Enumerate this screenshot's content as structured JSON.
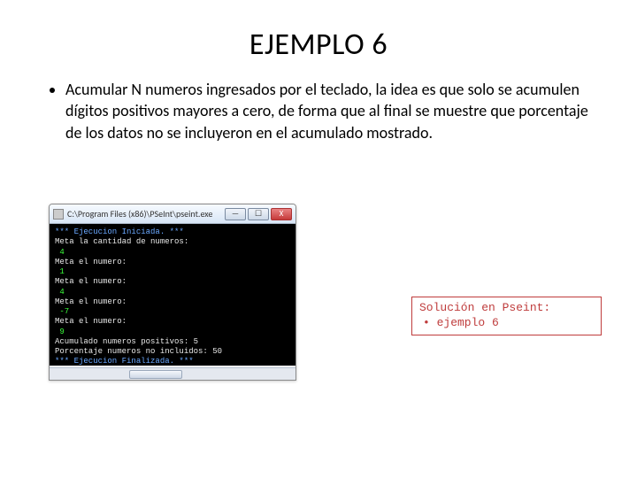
{
  "title": "EJEMPLO 6",
  "bullet": "Acumular N numeros ingresados por el teclado, la idea es que solo se acumulen dígitos positivos mayores a cero, de forma que al final se muestre que porcentaje de los datos no se incluyeron en el acumulado mostrado.",
  "console": {
    "window_title": "C:\\Program Files (x86)\\PSeInt\\pseint.exe",
    "min": "—",
    "max": "☐",
    "close": "X",
    "lines": [
      {
        "cls": "c-blue",
        "text": "*** Ejecucion Iniciada. ***"
      },
      {
        "cls": "c-white",
        "text": "Meta la cantidad de numeros:"
      },
      {
        "cls": "c-green",
        "text": " 4"
      },
      {
        "cls": "c-white",
        "text": "Meta el numero:"
      },
      {
        "cls": "c-green",
        "text": " 1"
      },
      {
        "cls": "c-white",
        "text": "Meta el numero:"
      },
      {
        "cls": "c-green",
        "text": " 4"
      },
      {
        "cls": "c-white",
        "text": "Meta el numero:"
      },
      {
        "cls": "c-green",
        "text": " -7"
      },
      {
        "cls": "c-white",
        "text": "Meta el numero:"
      },
      {
        "cls": "c-green",
        "text": " 9"
      },
      {
        "cls": "c-white",
        "text": "Acumulado numeros positivos: 5"
      },
      {
        "cls": "c-white",
        "text": "Porcentaje numeros no incluidos: 50"
      },
      {
        "cls": "c-blue",
        "text": "*** Ejecucion Finalizada. ***"
      }
    ]
  },
  "solution": {
    "heading": "Solución en Pseint:",
    "bullet": "• ejemplo 6"
  }
}
